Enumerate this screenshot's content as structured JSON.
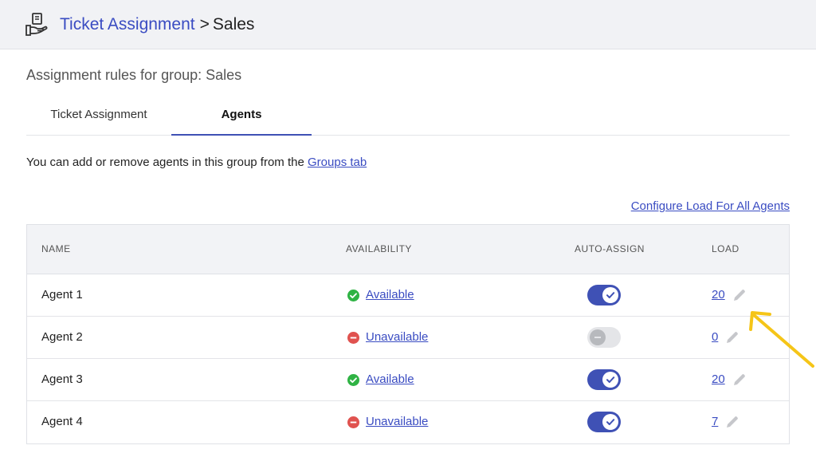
{
  "header": {
    "icon": "hand-ticket-icon",
    "crumb_parent": "Ticket Assignment",
    "crumb_separator": ">",
    "crumb_current": "Sales"
  },
  "section_title": "Assignment rules for group: Sales",
  "tabs": [
    {
      "label": "Ticket Assignment",
      "active": false
    },
    {
      "label": "Agents",
      "active": true
    }
  ],
  "info": {
    "text": "You can add or remove agents in this group from the ",
    "link": "Groups tab"
  },
  "configure_link": "Configure Load For All Agents",
  "table": {
    "headers": {
      "name": "NAME",
      "availability": "AVAILABILITY",
      "auto_assign": "AUTO-ASSIGN",
      "load": "LOAD"
    },
    "rows": [
      {
        "name": "Agent 1",
        "availability": "Available",
        "status_icon": "check-circle-icon",
        "auto_assign": true,
        "load": "20"
      },
      {
        "name": "Agent 2",
        "availability": "Unavailable",
        "status_icon": "minus-circle-icon",
        "auto_assign": false,
        "load": "0"
      },
      {
        "name": "Agent 3",
        "availability": "Available",
        "status_icon": "check-circle-icon",
        "auto_assign": true,
        "load": "20"
      },
      {
        "name": "Agent 4",
        "availability": "Unavailable",
        "status_icon": "minus-circle-icon",
        "auto_assign": true,
        "load": "7"
      }
    ]
  },
  "colors": {
    "accent": "#3f51b5",
    "link": "#3a4cc2",
    "available": "#2fb344",
    "unavailable": "#e0524f",
    "annotation_arrow": "#f5c518"
  }
}
